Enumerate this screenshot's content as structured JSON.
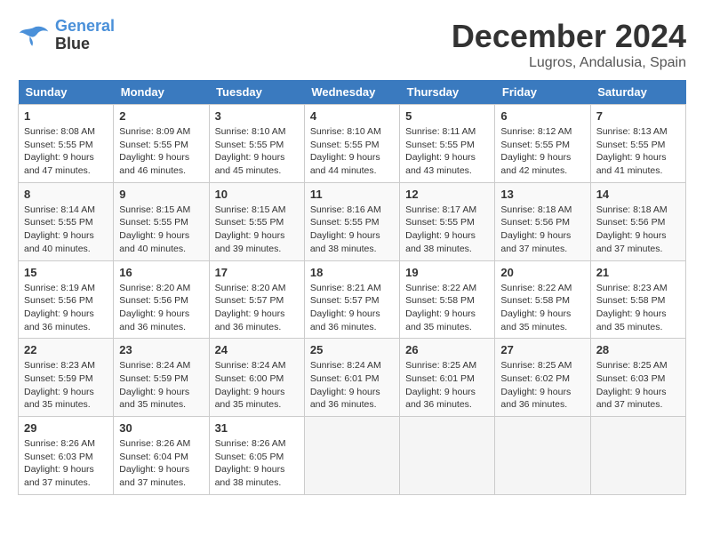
{
  "logo": {
    "line1": "General",
    "line2": "Blue"
  },
  "title": "December 2024",
  "location": "Lugros, Andalusia, Spain",
  "headers": [
    "Sunday",
    "Monday",
    "Tuesday",
    "Wednesday",
    "Thursday",
    "Friday",
    "Saturday"
  ],
  "weeks": [
    [
      {
        "day": "1",
        "sunrise": "8:08 AM",
        "sunset": "5:55 PM",
        "daylight": "9 hours and 47 minutes."
      },
      {
        "day": "2",
        "sunrise": "8:09 AM",
        "sunset": "5:55 PM",
        "daylight": "9 hours and 46 minutes."
      },
      {
        "day": "3",
        "sunrise": "8:10 AM",
        "sunset": "5:55 PM",
        "daylight": "9 hours and 45 minutes."
      },
      {
        "day": "4",
        "sunrise": "8:10 AM",
        "sunset": "5:55 PM",
        "daylight": "9 hours and 44 minutes."
      },
      {
        "day": "5",
        "sunrise": "8:11 AM",
        "sunset": "5:55 PM",
        "daylight": "9 hours and 43 minutes."
      },
      {
        "day": "6",
        "sunrise": "8:12 AM",
        "sunset": "5:55 PM",
        "daylight": "9 hours and 42 minutes."
      },
      {
        "day": "7",
        "sunrise": "8:13 AM",
        "sunset": "5:55 PM",
        "daylight": "9 hours and 41 minutes."
      }
    ],
    [
      {
        "day": "8",
        "sunrise": "8:14 AM",
        "sunset": "5:55 PM",
        "daylight": "9 hours and 40 minutes."
      },
      {
        "day": "9",
        "sunrise": "8:15 AM",
        "sunset": "5:55 PM",
        "daylight": "9 hours and 40 minutes."
      },
      {
        "day": "10",
        "sunrise": "8:15 AM",
        "sunset": "5:55 PM",
        "daylight": "9 hours and 39 minutes."
      },
      {
        "day": "11",
        "sunrise": "8:16 AM",
        "sunset": "5:55 PM",
        "daylight": "9 hours and 38 minutes."
      },
      {
        "day": "12",
        "sunrise": "8:17 AM",
        "sunset": "5:55 PM",
        "daylight": "9 hours and 38 minutes."
      },
      {
        "day": "13",
        "sunrise": "8:18 AM",
        "sunset": "5:56 PM",
        "daylight": "9 hours and 37 minutes."
      },
      {
        "day": "14",
        "sunrise": "8:18 AM",
        "sunset": "5:56 PM",
        "daylight": "9 hours and 37 minutes."
      }
    ],
    [
      {
        "day": "15",
        "sunrise": "8:19 AM",
        "sunset": "5:56 PM",
        "daylight": "9 hours and 36 minutes."
      },
      {
        "day": "16",
        "sunrise": "8:20 AM",
        "sunset": "5:56 PM",
        "daylight": "9 hours and 36 minutes."
      },
      {
        "day": "17",
        "sunrise": "8:20 AM",
        "sunset": "5:57 PM",
        "daylight": "9 hours and 36 minutes."
      },
      {
        "day": "18",
        "sunrise": "8:21 AM",
        "sunset": "5:57 PM",
        "daylight": "9 hours and 36 minutes."
      },
      {
        "day": "19",
        "sunrise": "8:22 AM",
        "sunset": "5:58 PM",
        "daylight": "9 hours and 35 minutes."
      },
      {
        "day": "20",
        "sunrise": "8:22 AM",
        "sunset": "5:58 PM",
        "daylight": "9 hours and 35 minutes."
      },
      {
        "day": "21",
        "sunrise": "8:23 AM",
        "sunset": "5:58 PM",
        "daylight": "9 hours and 35 minutes."
      }
    ],
    [
      {
        "day": "22",
        "sunrise": "8:23 AM",
        "sunset": "5:59 PM",
        "daylight": "9 hours and 35 minutes."
      },
      {
        "day": "23",
        "sunrise": "8:24 AM",
        "sunset": "5:59 PM",
        "daylight": "9 hours and 35 minutes."
      },
      {
        "day": "24",
        "sunrise": "8:24 AM",
        "sunset": "6:00 PM",
        "daylight": "9 hours and 35 minutes."
      },
      {
        "day": "25",
        "sunrise": "8:24 AM",
        "sunset": "6:01 PM",
        "daylight": "9 hours and 36 minutes."
      },
      {
        "day": "26",
        "sunrise": "8:25 AM",
        "sunset": "6:01 PM",
        "daylight": "9 hours and 36 minutes."
      },
      {
        "day": "27",
        "sunrise": "8:25 AM",
        "sunset": "6:02 PM",
        "daylight": "9 hours and 36 minutes."
      },
      {
        "day": "28",
        "sunrise": "8:25 AM",
        "sunset": "6:03 PM",
        "daylight": "9 hours and 37 minutes."
      }
    ],
    [
      {
        "day": "29",
        "sunrise": "8:26 AM",
        "sunset": "6:03 PM",
        "daylight": "9 hours and 37 minutes."
      },
      {
        "day": "30",
        "sunrise": "8:26 AM",
        "sunset": "6:04 PM",
        "daylight": "9 hours and 37 minutes."
      },
      {
        "day": "31",
        "sunrise": "8:26 AM",
        "sunset": "6:05 PM",
        "daylight": "9 hours and 38 minutes."
      },
      null,
      null,
      null,
      null
    ]
  ],
  "labels": {
    "sunrise": "Sunrise:",
    "sunset": "Sunset:",
    "daylight": "Daylight:"
  }
}
